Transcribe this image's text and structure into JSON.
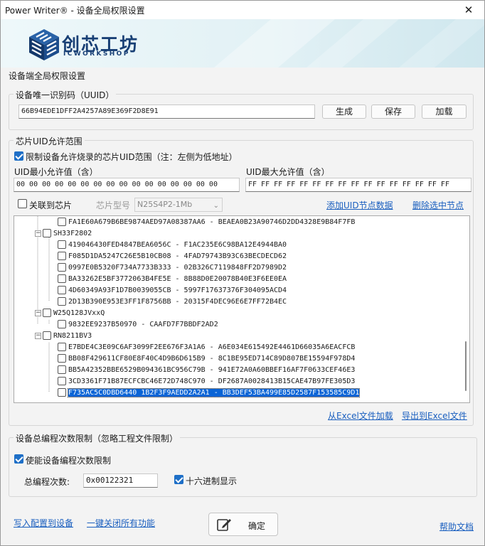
{
  "window": {
    "title": "Power Writer® - 设备全局权限设置",
    "close_glyph": "✕"
  },
  "banner": {
    "logo_cn": "创芯工坊",
    "logo_en": "ICWORKSHOP",
    "icon": "cube-logo-icon"
  },
  "section_title": "设备端全局权限设置",
  "uuid_group": {
    "title": "设备唯一识别码（UUID）",
    "value": "66B94EDE1DFF2A4257A89E369F2D8E91",
    "generate_label": "生成",
    "save_label": "保存",
    "load_label": "加载"
  },
  "uid_group": {
    "title": "芯片UID允许范围",
    "restrict_label": "限制设备允许烧录的芯片UID范围（注：左侧为低地址）",
    "restrict_checked": true,
    "min_label": "UID最小允许值（含）",
    "max_label": "UID最大允许值（含）",
    "min_value": "00 00 00 00 00 00 00 00 00 00 00 00 00 00 00 00",
    "max_value": "FF FF FF FF FF FF FF FF FF FF FF FF FF FF FF FF",
    "link_chip_label": "关联到芯片",
    "link_chip_checked": false,
    "chip_model_label": "芯片型号",
    "chip_model_value": "N25S4P2-1Mb",
    "add_node_label": "添加UID节点数据",
    "delete_node_label": "删除选中节点",
    "tree": [
      {
        "level": 2,
        "text": "FA1E60A679B6BE9874AED97A08387AA6 - BEAEA0B23A90746D2DD4328E9B84F7FB",
        "selected": false
      },
      {
        "level": 1,
        "text": "SH33F2802",
        "expander": "−"
      },
      {
        "level": 2,
        "text": "419046430FED4847BEA6056C - F1AC235E6C98BA12E4944BA0",
        "selected": false
      },
      {
        "level": 2,
        "text": "F085D1DA5247C26E5B10CB08 - 4FAD79743B93C63BECDECD62",
        "selected": false
      },
      {
        "level": 2,
        "text": "0997E0B5320F734A7733B333 - 02B326C7119848FF2D7989D2",
        "selected": false
      },
      {
        "level": 2,
        "text": "BA33262E5BF3772063B4FE5E - 8B88D0E20078B40E3F6EE0EA",
        "selected": false
      },
      {
        "level": 2,
        "text": "4D60349A93F1D7B0039055CB - 5997F17637376F304095ACD4",
        "selected": false
      },
      {
        "level": 2,
        "text": "2D13B390E953E3FF1F8756BB - 20315F4DEC96E6E7FF72B4EC",
        "selected": false
      },
      {
        "level": 1,
        "text": "W25Q128JVxxQ",
        "expander": "−"
      },
      {
        "level": 2,
        "text": "9832EE9237B50970 - CAAFD7F7BBDF2AD2",
        "selected": false
      },
      {
        "level": 1,
        "text": "RN8211BV3",
        "expander": "−"
      },
      {
        "level": 2,
        "text": "E7BDE4C3E09C6AF3099F2EE676F3A1A6 - A6E034E615492E4461D66035A6EACFCB",
        "selected": false
      },
      {
        "level": 2,
        "text": "BB08F429611CF80E8F40C4D9B6D615B9 - 8C1BE95ED714C89D807BE15594F978D4",
        "selected": false
      },
      {
        "level": 2,
        "text": "BB5A42352BBE6529B094361BC956C79B - 941E72A0A60BBEF16AF7F0633CEF46E3",
        "selected": false
      },
      {
        "level": 2,
        "text": "3CD3361F71B87ECFCBC46E72D748C970 - DF2687A0028413B15CAE47B97FE305D3",
        "selected": false
      },
      {
        "level": 2,
        "text": "F735AC5C0DBD6440 1B2F3F9AEDD2A2A1 - BB3DEF53BA499E85D2587F153585C9D1",
        "selected": true
      }
    ],
    "import_excel_label": "从Excel文件加载",
    "export_excel_label": "导出到Excel文件"
  },
  "count_group": {
    "title": "设备总编程次数限制（忽略工程文件限制）",
    "enable_label": "使能设备编程次数限制",
    "enable_checked": true,
    "total_label": "总编程次数:",
    "total_value": "0x00122321",
    "hex_label": "十六进制显示",
    "hex_checked": true
  },
  "footer": {
    "write_config_label": "写入配置到设备",
    "disable_all_label": "一键关闭所有功能",
    "ok_label": "确定",
    "ok_icon": "edit-document-icon",
    "help_label": "帮助文档"
  },
  "colors": {
    "accent": "#1e6fc7",
    "link": "#1a5fbf",
    "selection": "#0a64d6",
    "logo": "#183f75"
  }
}
